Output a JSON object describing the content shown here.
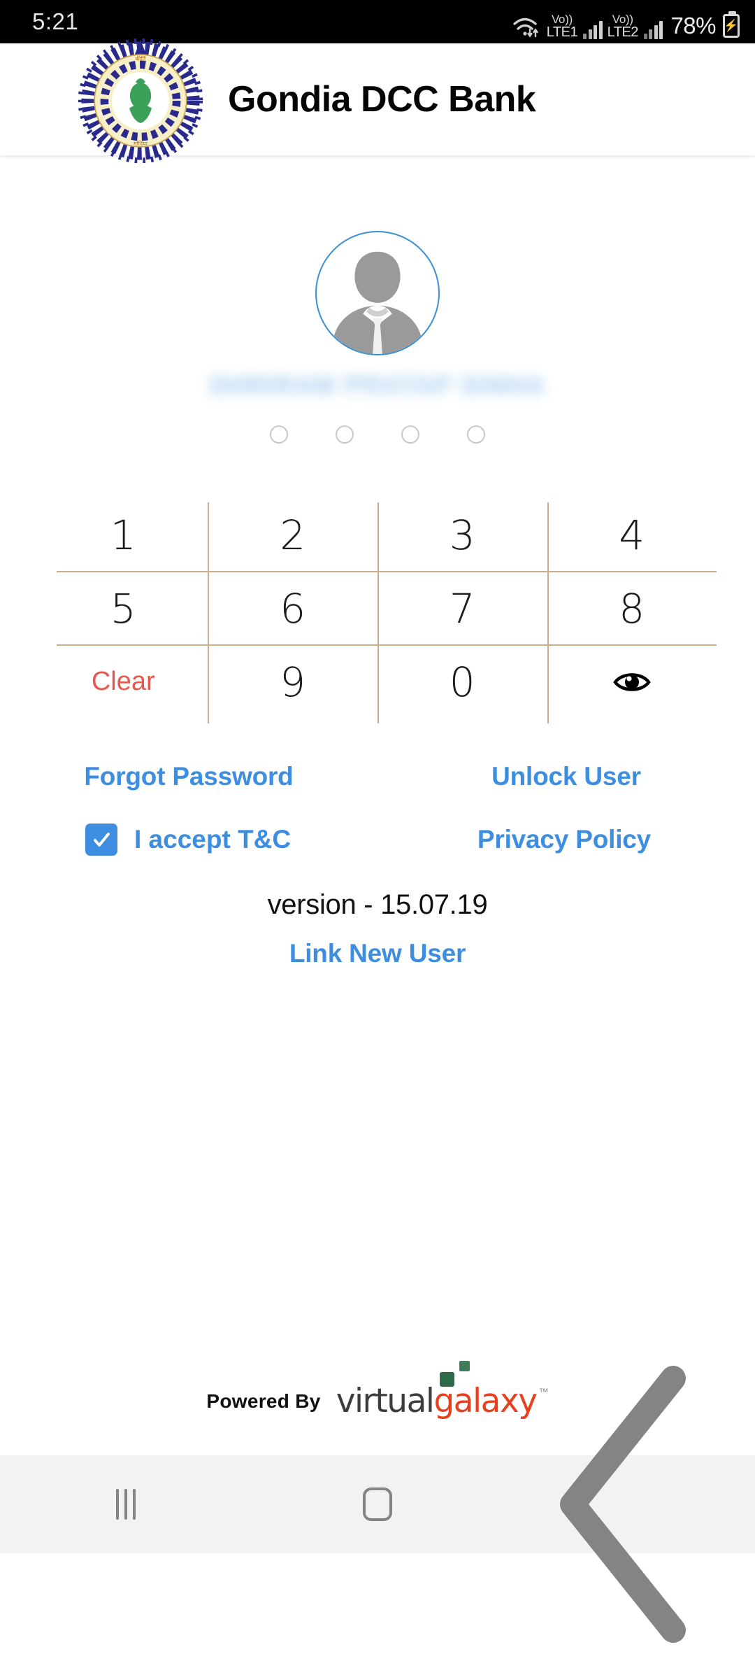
{
  "status_bar": {
    "time": "5:21",
    "wifi_icon": "wifi-icon",
    "sim1": {
      "volte_label": "Vo))",
      "network_label": "LTE1"
    },
    "sim2": {
      "volte_label": "Vo))",
      "network_label": "LTE2"
    },
    "battery_percent": "78%",
    "battery_icon": "battery-charging-icon"
  },
  "header": {
    "title": "Gondia DCC Bank",
    "logo_icon": "bank-emblem-logo"
  },
  "login": {
    "avatar_icon": "user-avatar-icon",
    "username_masked": "SHRIRAM PRATAP SINHA",
    "pin_dots": [
      {
        "filled": false
      },
      {
        "filled": false
      },
      {
        "filled": false
      },
      {
        "filled": false
      }
    ],
    "keypad": [
      [
        {
          "label": "1",
          "type": "digit"
        },
        {
          "label": "2",
          "type": "digit"
        },
        {
          "label": "3",
          "type": "digit"
        },
        {
          "label": "4",
          "type": "digit"
        }
      ],
      [
        {
          "label": "5",
          "type": "digit"
        },
        {
          "label": "6",
          "type": "digit"
        },
        {
          "label": "7",
          "type": "digit"
        },
        {
          "label": "8",
          "type": "digit"
        }
      ],
      [
        {
          "label": "Clear",
          "type": "clear"
        },
        {
          "label": "9",
          "type": "digit"
        },
        {
          "label": "0",
          "type": "digit"
        },
        {
          "label": "",
          "type": "eye",
          "icon": "eye-icon"
        }
      ]
    ],
    "forgot_password_label": "Forgot Password",
    "unlock_user_label": "Unlock User",
    "accept_tc_label": "I accept T&C",
    "accept_tc_checked": true,
    "privacy_policy_label": "Privacy Policy",
    "version_label": "version - 15.07.19",
    "link_new_user_label": "Link New User"
  },
  "footer": {
    "powered_by_label": "Powered By",
    "brand_part1": "virtual",
    "brand_part2": "galaxy",
    "trademark": "™"
  },
  "nav_bar": {
    "recents_icon": "recents-icon",
    "home_icon": "home-icon",
    "back_icon": "back-chevron-icon"
  },
  "colors": {
    "accent_blue": "#3d8ee0",
    "clear_red": "#e4584f",
    "grid_line": "#cfab8d",
    "brand_red": "#e8401f",
    "brand_green": "#2e6b4a"
  }
}
